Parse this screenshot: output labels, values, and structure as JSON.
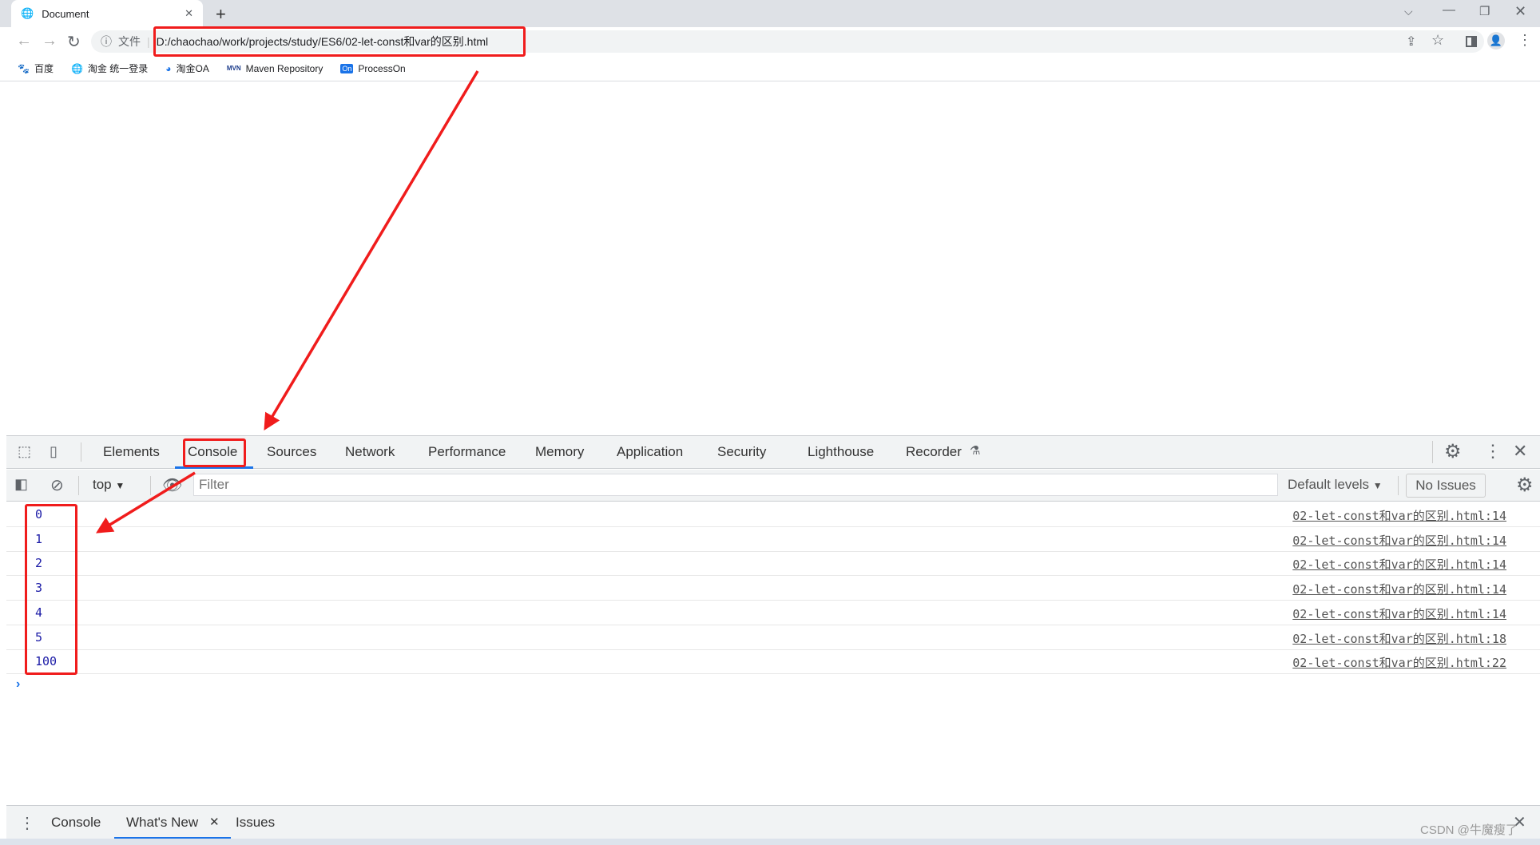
{
  "browser": {
    "tab_title": "Document",
    "url_prefix": "文件",
    "url": "D:/chaochao/work/projects/study/ES6/02-let-const和var的区别.html",
    "bookmarks": [
      {
        "label": "百度",
        "icon": "baidu-icon"
      },
      {
        "label": "淘金 统一登录",
        "icon": "globe-icon"
      },
      {
        "label": "淘金OA",
        "icon": "oa-icon"
      },
      {
        "label": "Maven Repository",
        "icon": "maven-icon"
      },
      {
        "label": "ProcessOn",
        "icon": "processon-icon"
      }
    ]
  },
  "devtools": {
    "tabs": [
      "Elements",
      "Console",
      "Sources",
      "Network",
      "Performance",
      "Memory",
      "Application",
      "Security",
      "Lighthouse",
      "Recorder"
    ],
    "active_tab": "Console",
    "context": "top",
    "filter_placeholder": "Filter",
    "levels": "Default levels",
    "issues": "No Issues",
    "logs": [
      {
        "value": "0",
        "source": "02-let-const和var的区别.html:14"
      },
      {
        "value": "1",
        "source": "02-let-const和var的区别.html:14"
      },
      {
        "value": "2",
        "source": "02-let-const和var的区别.html:14"
      },
      {
        "value": "3",
        "source": "02-let-const和var的区别.html:14"
      },
      {
        "value": "4",
        "source": "02-let-const和var的区别.html:14"
      },
      {
        "value": "5",
        "source": "02-let-const和var的区别.html:18"
      },
      {
        "value": "100",
        "source": "02-let-const和var的区别.html:22"
      }
    ],
    "drawer_tabs": [
      "Console",
      "What's New",
      "Issues"
    ]
  },
  "watermark": "CSDN @牛魔瘦了",
  "colors": {
    "annotation": "#f01c1c",
    "accent": "#1a73e8",
    "log_value": "#1a1aa6"
  }
}
